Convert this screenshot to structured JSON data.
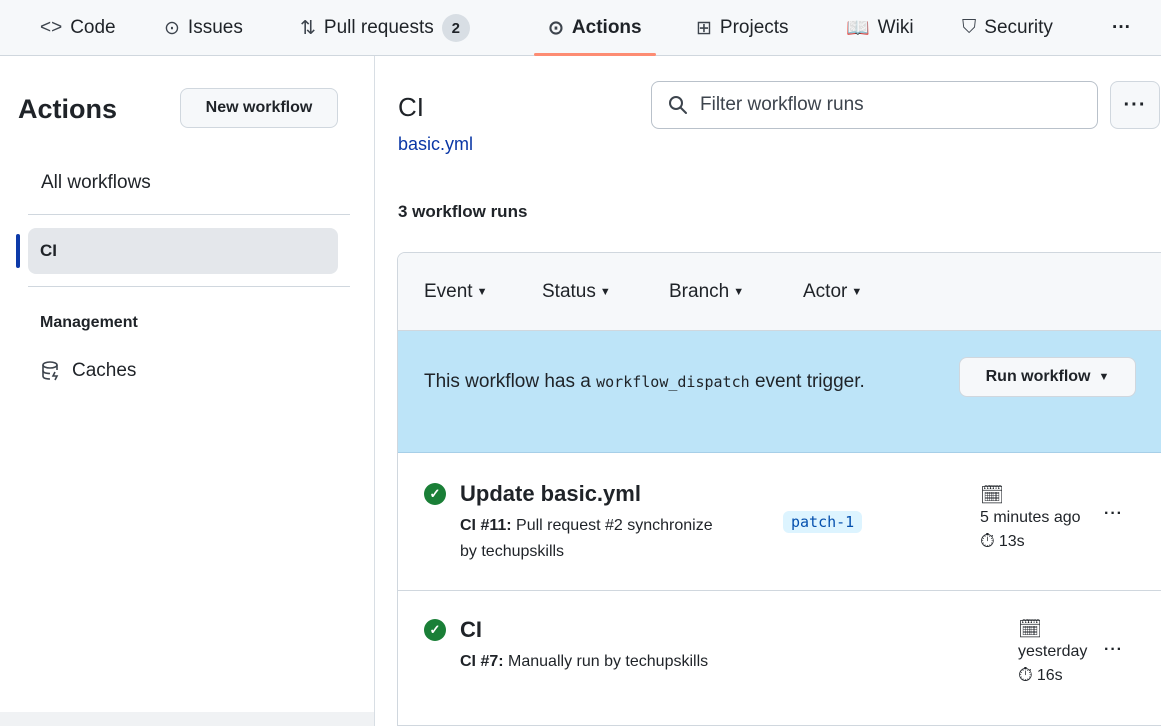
{
  "nav": {
    "tabs": [
      {
        "icon": "code-icon",
        "glyph": "<>",
        "label": "Code"
      },
      {
        "icon": "issues-icon",
        "glyph": "⊙",
        "label": "Issues"
      },
      {
        "icon": "pull-request-icon",
        "glyph": "⇅",
        "label": "Pull requests",
        "count": "2"
      },
      {
        "icon": "actions-icon",
        "glyph": "⊙",
        "label": "Actions",
        "active": true
      },
      {
        "icon": "projects-icon",
        "glyph": "⊞",
        "label": "Projects"
      },
      {
        "icon": "wiki-icon",
        "glyph": "📖",
        "label": "Wiki"
      },
      {
        "icon": "security-icon",
        "glyph": "⛉",
        "label": "Security"
      }
    ],
    "more": "···"
  },
  "sidebar": {
    "title": "Actions",
    "new_workflow": "New workflow",
    "all_workflows": "All workflows",
    "active_workflow": "CI",
    "management_heading": "Management",
    "caches": "Caches"
  },
  "main": {
    "workflow_title": "CI",
    "workflow_file": "basic.yml",
    "search_placeholder": "Filter workflow runs",
    "runs_count": "3 workflow runs",
    "filters": [
      "Event",
      "Status",
      "Branch",
      "Actor"
    ],
    "banner": {
      "prefix": "This workflow has a",
      "code": "workflow_dispatch",
      "suffix": "event trigger.",
      "run_button": "Run workflow"
    },
    "runs": [
      {
        "title": "Update basic.yml",
        "run_label": "CI #11:",
        "description": "Pull request #2 synchronize",
        "actor_line": "by techupskills",
        "branch": "patch-1",
        "time": "5 minutes ago",
        "duration": "13s",
        "status_color": "#1a7f37"
      },
      {
        "title": "CI",
        "run_label": "CI #7:",
        "description": "Manually run by techupskills",
        "actor_line": "",
        "branch": "",
        "time": "yesterday",
        "duration": "16s",
        "status_color": "#1a7f37"
      }
    ]
  },
  "colors": {
    "accent_underline": "#fd8c73",
    "active_marker": "#0d3aa9",
    "banner_bg": "#bde4f8",
    "link": "#0a37a6"
  }
}
